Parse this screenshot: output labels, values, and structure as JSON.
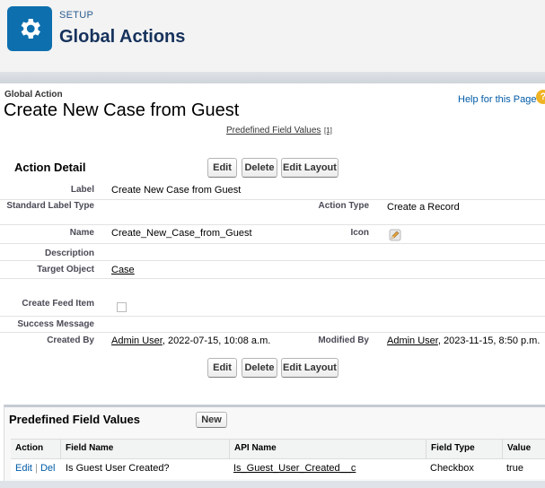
{
  "header": {
    "section_label": "SETUP",
    "title": "Global Actions",
    "icon": "gear-icon",
    "accent_color": "#0d6fae"
  },
  "page": {
    "type_label": "Global Action",
    "title": "Create New Case from Guest",
    "help_link": "Help for this Page",
    "help_icon": "question-icon",
    "predefined_link": "Predefined Field Values",
    "predefined_count": "[1]"
  },
  "detail": {
    "title": "Action Detail",
    "buttons": {
      "edit": "Edit",
      "delete": "Delete",
      "edit_layout": "Edit Layout"
    },
    "fields": {
      "label": {
        "name": "Label",
        "value": "Create New Case from Guest"
      },
      "standard_label_type": {
        "name": "Standard Label Type",
        "value": ""
      },
      "action_type": {
        "name": "Action Type",
        "value": "Create a Record"
      },
      "api_name": {
        "name": "Name",
        "value": "Create_New_Case_from_Guest"
      },
      "icon": {
        "name": "Icon",
        "value": "pencil-icon"
      },
      "description": {
        "name": "Description",
        "value": ""
      },
      "target_object": {
        "name": "Target Object",
        "value": "Case"
      },
      "create_feed_item": {
        "name": "Create Feed Item",
        "checked": false
      },
      "success_message": {
        "name": "Success Message",
        "value": ""
      },
      "created_by": {
        "name": "Created By",
        "user": "Admin User",
        "date": ", 2022-07-15, 10:08 a.m."
      },
      "modified_by": {
        "name": "Modified By",
        "user": "Admin User",
        "date": ", 2023-11-15, 8:50 p.m."
      }
    }
  },
  "related": {
    "title": "Predefined Field Values",
    "new_button": "New",
    "columns": [
      "Action",
      "Field Name",
      "API Name",
      "Field Type",
      "Value"
    ],
    "rows": [
      {
        "edit": "Edit",
        "sep": "|",
        "del": "Del",
        "field_name": "Is Guest User Created?",
        "api_name": "Is_Guest_User_Created__c",
        "field_type": "Checkbox",
        "value": "true"
      }
    ]
  }
}
